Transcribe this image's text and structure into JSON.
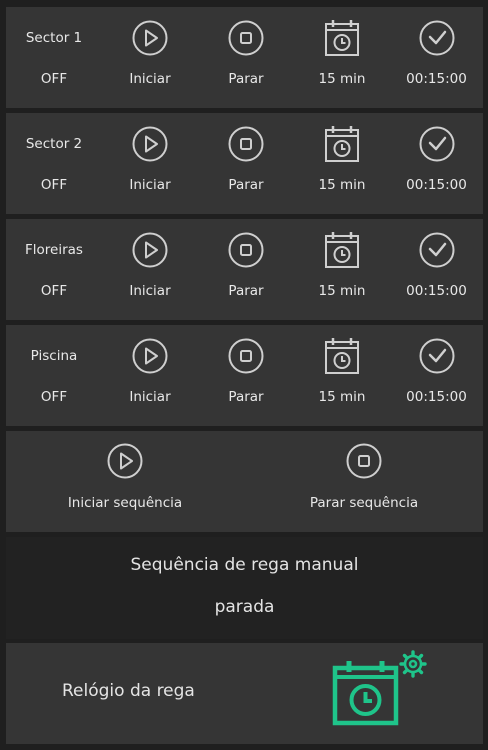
{
  "zones": [
    {
      "name": "Sector 1",
      "status": "OFF",
      "start_label": "Iniciar",
      "stop_label": "Parar",
      "duration": "15 min",
      "remaining": "00:15:00"
    },
    {
      "name": "Sector 2",
      "status": "OFF",
      "start_label": "Iniciar",
      "stop_label": "Parar",
      "duration": "15 min",
      "remaining": "00:15:00"
    },
    {
      "name": "Floreiras",
      "status": "OFF",
      "start_label": "Iniciar",
      "stop_label": "Parar",
      "duration": "15 min",
      "remaining": "00:15:00"
    },
    {
      "name": "Piscina",
      "status": "OFF",
      "start_label": "Iniciar",
      "stop_label": "Parar",
      "duration": "15 min",
      "remaining": "00:15:00"
    }
  ],
  "sequence": {
    "start_label": "Iniciar sequência",
    "stop_label": "Parar sequência"
  },
  "status": {
    "line1": "Sequência de rega manual",
    "line2": "parada"
  },
  "irrigation_clock": {
    "label": "Relógio da rega",
    "icon": "calendar-clock-icon",
    "badge_icon": "gear-icon"
  },
  "colors": {
    "accent": "#1fc48a",
    "card_bg": "#353535",
    "page_bg": "#1f1f1f",
    "icon_stroke": "#cfcfcf"
  }
}
